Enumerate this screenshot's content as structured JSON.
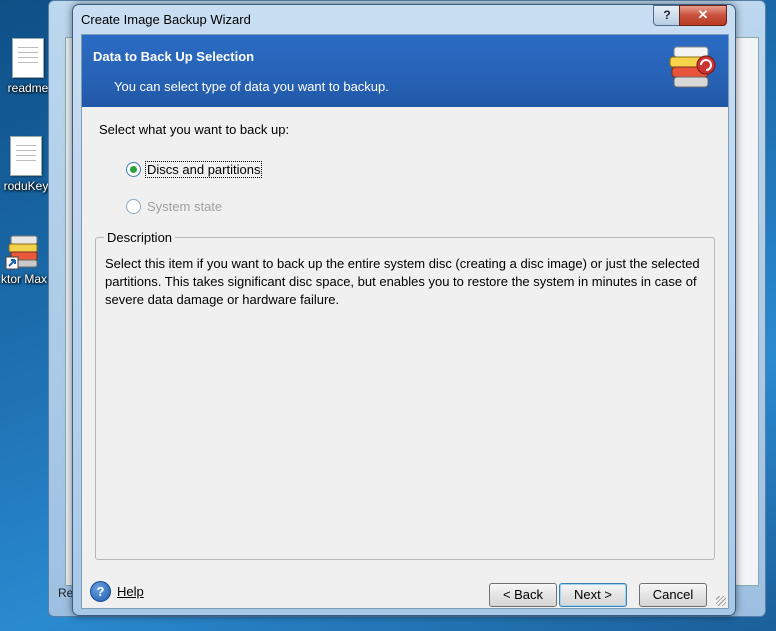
{
  "desktop": {
    "icons": [
      {
        "label": "readme"
      },
      {
        "label": "roduKey"
      },
      {
        "label": "ktor Max"
      }
    ]
  },
  "background_window": {
    "status_text": "Re"
  },
  "wizard": {
    "title": "Create Image Backup Wizard",
    "help_button": "?",
    "close_button": "✕",
    "header": {
      "title": "Data to Back Up Selection",
      "subtitle": "You can select type of data you want to backup."
    },
    "prompt": "Select what you want to back up:",
    "options": [
      {
        "label": "Discs and partitions",
        "checked": true,
        "enabled": true
      },
      {
        "label": "System state",
        "checked": false,
        "enabled": false
      }
    ],
    "description": {
      "legend": "Description",
      "text": "Select this item if you want to back up the entire system disc (creating a disc image) or just the selected partitions. This takes significant disc space, but enables you to restore the system in minutes in case of severe data damage or hardware failure."
    },
    "footer": {
      "help_label": "Help",
      "help_icon_glyph": "?",
      "back_label": "< Back",
      "next_label": "Next >",
      "cancel_label": "Cancel"
    }
  }
}
